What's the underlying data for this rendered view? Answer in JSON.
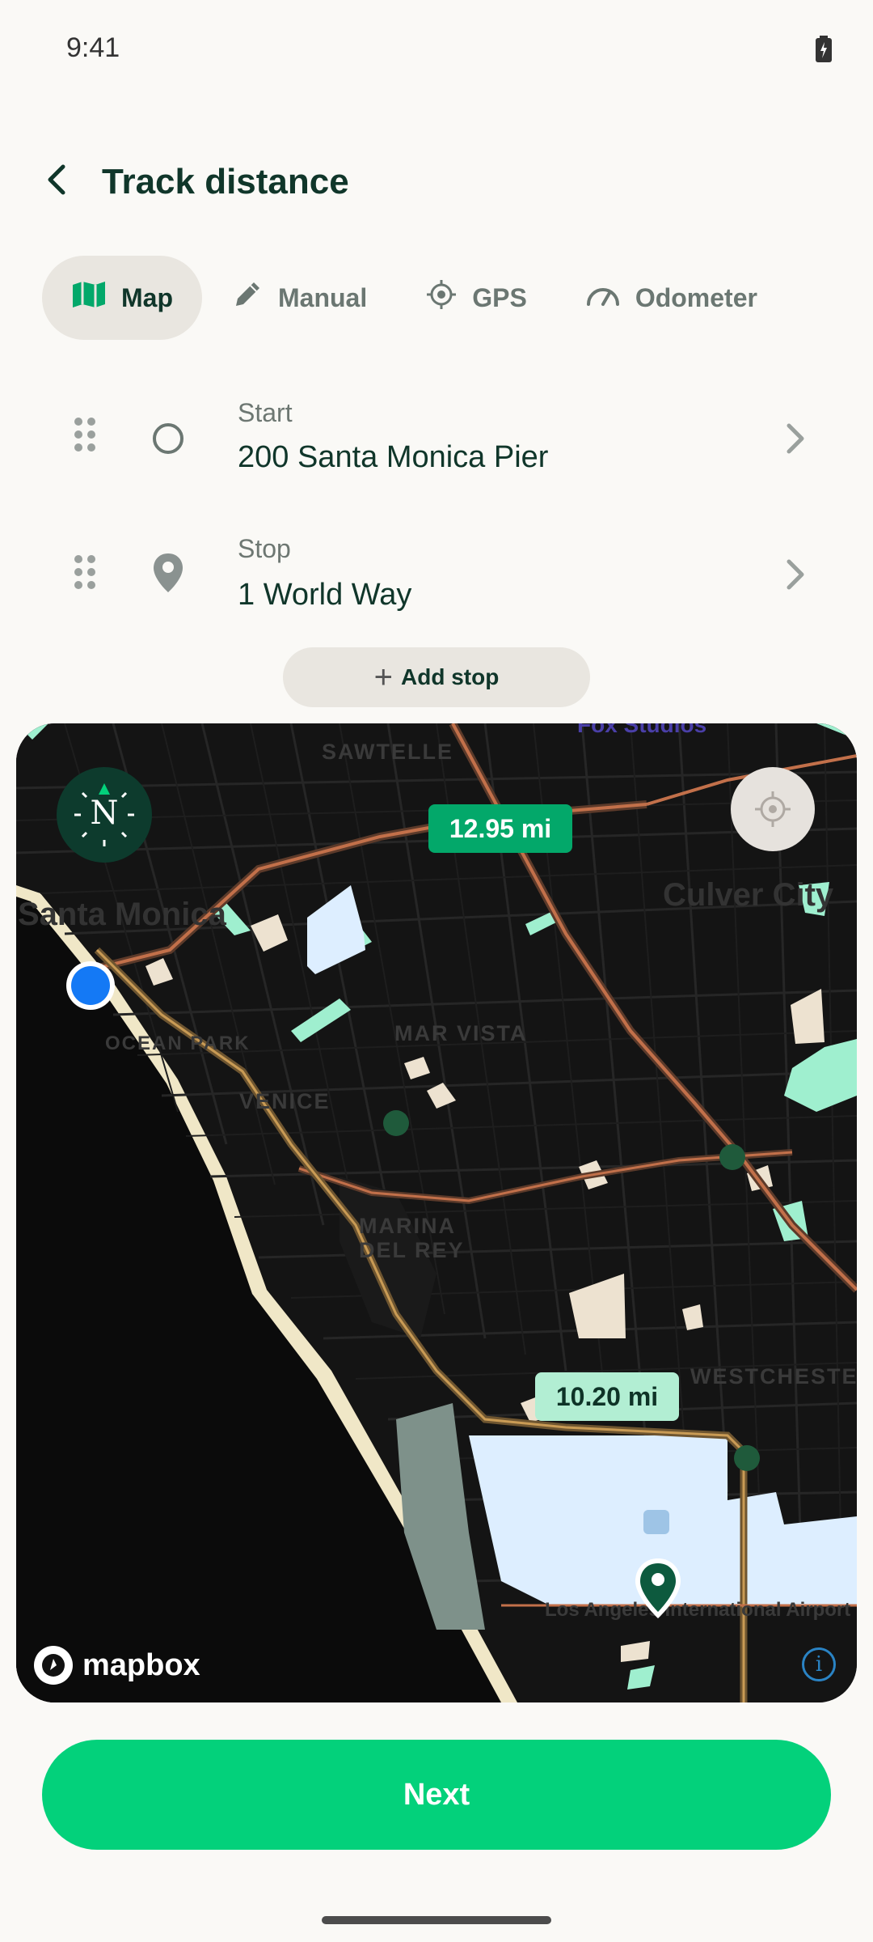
{
  "status_bar": {
    "time": "9:41",
    "battery_icon": "battery-charging-icon"
  },
  "header": {
    "title": "Track distance",
    "back_icon": "back-chevron-icon"
  },
  "tabs": [
    {
      "label": "Map",
      "icon": "map-icon",
      "active": true
    },
    {
      "label": "Manual",
      "icon": "pencil-icon",
      "active": false
    },
    {
      "label": "GPS",
      "icon": "crosshair-icon",
      "active": false
    },
    {
      "label": "Odometer",
      "icon": "speedometer-icon",
      "active": false
    }
  ],
  "route": {
    "start": {
      "label": "Start",
      "value": "200 Santa Monica Pier"
    },
    "stop": {
      "label": "Stop",
      "value": "1 World Way"
    },
    "add_stop_label": "Add stop"
  },
  "map": {
    "compass_label": "N",
    "distance_main": "12.95 mi",
    "distance_alt": "10.20 mi",
    "attribution": "mapbox",
    "info_label": "i",
    "place_labels": [
      "SAWTELLE",
      "Santa Monica",
      "Culver City",
      "MAR VISTA",
      "OCEAN PARK",
      "VENICE",
      "MARINA DEL REY",
      "WESTCHESTER",
      "Los Angeles International Airport",
      "Fox Studios"
    ],
    "colors": {
      "route_primary": "#C2704A",
      "route_secondary": "#C99B55",
      "water": "#0E0E0E",
      "park": "#9FEFCF",
      "airport": "#DDEEFF",
      "start_dot": "#1479F5",
      "end_pin": "#0D5A3E"
    }
  },
  "footer": {
    "next_label": "Next"
  },
  "colors": {
    "accent": "#03D17B",
    "text_primary": "#10362A",
    "background": "#FAF9F6"
  }
}
